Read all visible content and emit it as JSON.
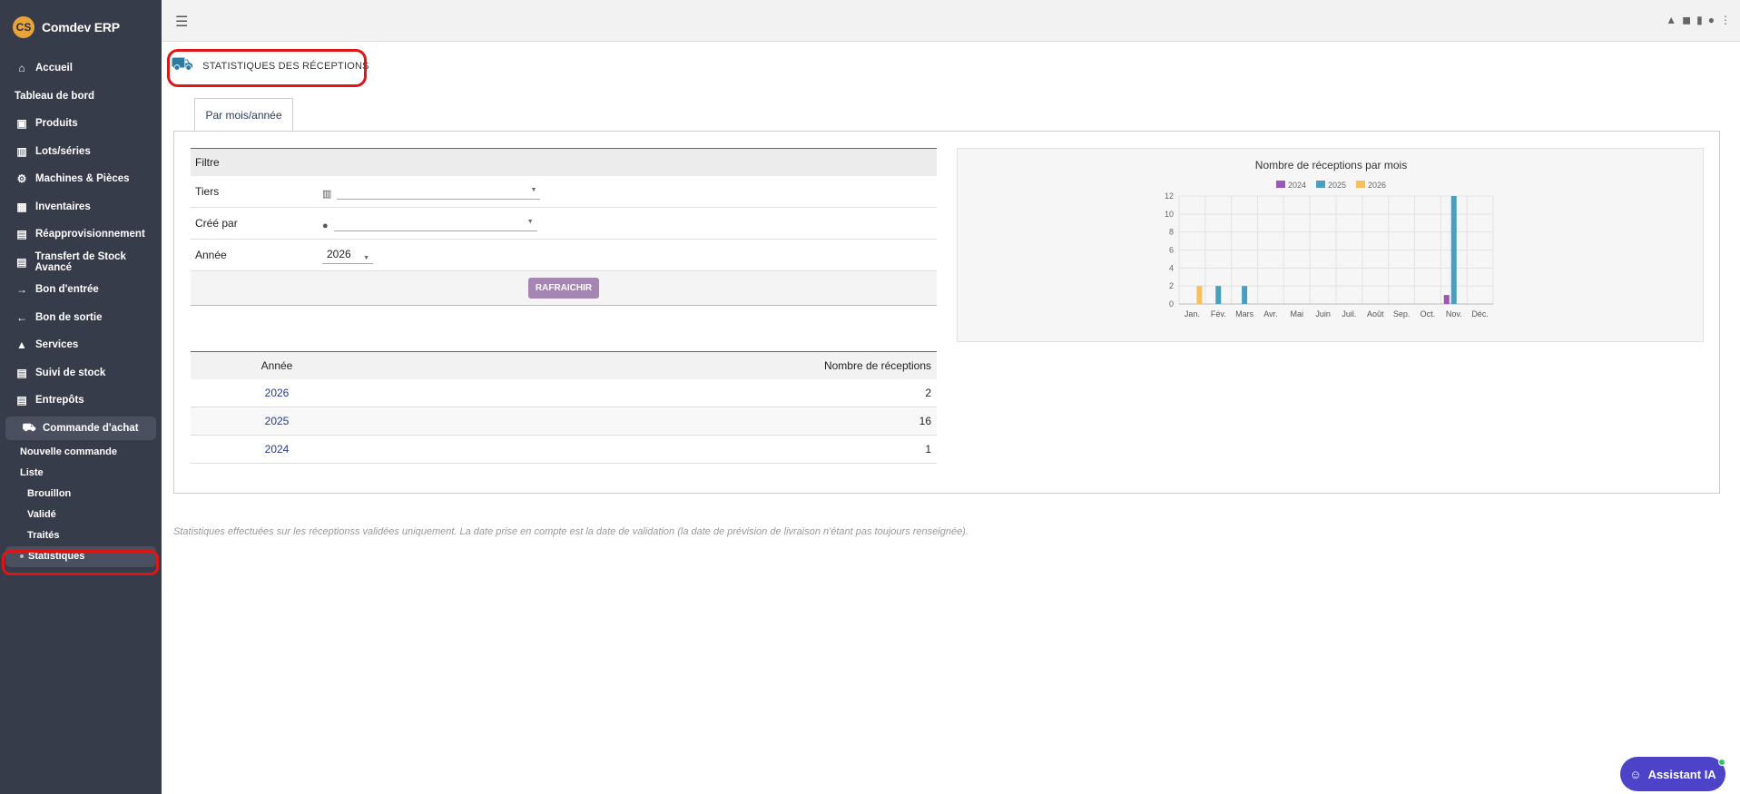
{
  "app": {
    "name": "Comdev ERP",
    "logo_text": "CS"
  },
  "sidebar": {
    "items": [
      {
        "label": "Accueil",
        "icon": "home-icon",
        "glyph": "⌂"
      },
      {
        "label": "Tableau de bord",
        "icon": "",
        "glyph": ""
      },
      {
        "label": "Produits",
        "icon": "cube-icon",
        "glyph": "▣"
      },
      {
        "label": "Lots/séries",
        "icon": "barcode-icon",
        "glyph": "▥"
      },
      {
        "label": "Machines & Pièces",
        "icon": "cogs-icon",
        "glyph": "⚙"
      },
      {
        "label": "Inventaires",
        "icon": "boxes-icon",
        "glyph": "▦"
      },
      {
        "label": "Réapprovisionnement",
        "icon": "box-icon",
        "glyph": "▤"
      },
      {
        "label": "Transfert de Stock Avancé",
        "icon": "box-icon",
        "glyph": "▤"
      },
      {
        "label": "Bon d'entrée",
        "icon": "arrow-right-icon",
        "glyph": "→"
      },
      {
        "label": "Bon de sortie",
        "icon": "arrow-left-icon",
        "glyph": "←"
      },
      {
        "label": "Services",
        "icon": "bell-icon",
        "glyph": "▲"
      },
      {
        "label": "Suivi de stock",
        "icon": "box-icon",
        "glyph": "▤"
      },
      {
        "label": "Entrepôts",
        "icon": "warehouse-icon",
        "glyph": "▤"
      },
      {
        "label": "Commande d'achat",
        "icon": "dolly-icon",
        "glyph": "⛟"
      }
    ],
    "sub": [
      "Nouvelle commande",
      "Liste"
    ],
    "sub2": [
      "Brouillon",
      "Validé",
      "Traités"
    ],
    "current": "Statistiques"
  },
  "page": {
    "title": "STATISTIQUES DES RÉCEPTIONS"
  },
  "tabs": [
    {
      "label": "Par mois/année"
    }
  ],
  "filter": {
    "heading": "Filtre",
    "tiers_label": "Tiers",
    "cree_par_label": "Créé par",
    "annee_label": "Année",
    "annee_value": "2026",
    "refresh_label": "RAFRAICHIR"
  },
  "table": {
    "headers": [
      "Année",
      "Nombre de réceptions"
    ],
    "rows": [
      {
        "year": "2026",
        "count": "2"
      },
      {
        "year": "2025",
        "count": "16"
      },
      {
        "year": "2024",
        "count": "1"
      }
    ]
  },
  "footnote": "Statistiques effectuées sur les réceptionss validées uniquement. La date prise en compte est la date de validation (la date de prévision de livraison n'étant pas toujours renseignée).",
  "assistant": {
    "label": "Assistant IA"
  },
  "chart_data": {
    "type": "bar",
    "title": "Nombre de réceptions par mois",
    "categories": [
      "Jan.",
      "Fév.",
      "Mars",
      "Avr.",
      "Mai",
      "Juin",
      "Juil.",
      "Août",
      "Sep.",
      "Oct.",
      "Nov.",
      "Déc."
    ],
    "series": [
      {
        "name": "2024",
        "color": "#9b59b6",
        "values": [
          0,
          0,
          0,
          0,
          0,
          0,
          0,
          0,
          0,
          0,
          1,
          0
        ]
      },
      {
        "name": "2025",
        "color": "#4a9fbf",
        "values": [
          0,
          2,
          2,
          0,
          0,
          0,
          0,
          0,
          0,
          0,
          12,
          0
        ]
      },
      {
        "name": "2026",
        "color": "#f5c060",
        "values": [
          2,
          0,
          0,
          0,
          0,
          0,
          0,
          0,
          0,
          0,
          0,
          0
        ]
      }
    ],
    "yticks": [
      0,
      2,
      4,
      6,
      8,
      10,
      12
    ],
    "ylim": [
      0,
      12
    ],
    "legend": "top",
    "grid": true
  }
}
